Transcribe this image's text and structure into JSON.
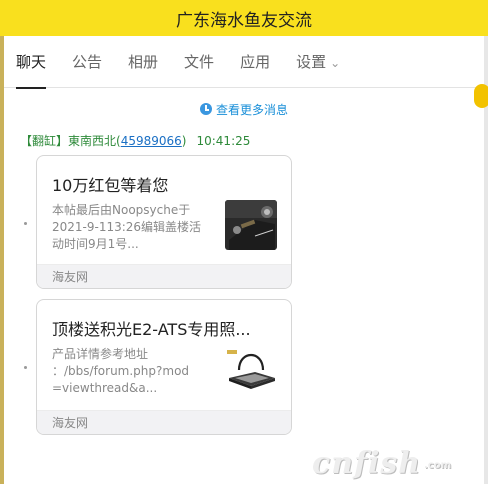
{
  "window": {
    "title": "广东海水鱼友交流"
  },
  "tabs": [
    {
      "label": "聊天",
      "active": true
    },
    {
      "label": "公告"
    },
    {
      "label": "相册"
    },
    {
      "label": "文件"
    },
    {
      "label": "应用"
    },
    {
      "label": "设置",
      "has_dropdown": true
    }
  ],
  "history_link": {
    "label": "查看更多消息",
    "icon": "clock-icon"
  },
  "message": {
    "tag": "【翻缸】",
    "sender": "東南西北",
    "qq_open": "(",
    "qq": "45989066",
    "qq_close": ")",
    "time": "10:41:25"
  },
  "cards": [
    {
      "title": "10万红包等着您",
      "desc": "本帖最后由Noopsyche于2021-9-113:26编辑盖楼活动时间9月1号...",
      "source": "海友网",
      "thumb": "product-photo-dark"
    },
    {
      "title": "顶楼送积光E2-ATS专用照...",
      "desc": "产品详情参考地址 ：/bbs/forum.php?mod =viewthread&a...",
      "source": "海友网",
      "thumb": "product-photo-light"
    }
  ],
  "watermark": {
    "brand": "cnfish",
    "suffix": ".com"
  },
  "colors": {
    "title_bar": "#f9e01e",
    "link": "#1a8fd8",
    "sender": "#2e8a3a"
  }
}
